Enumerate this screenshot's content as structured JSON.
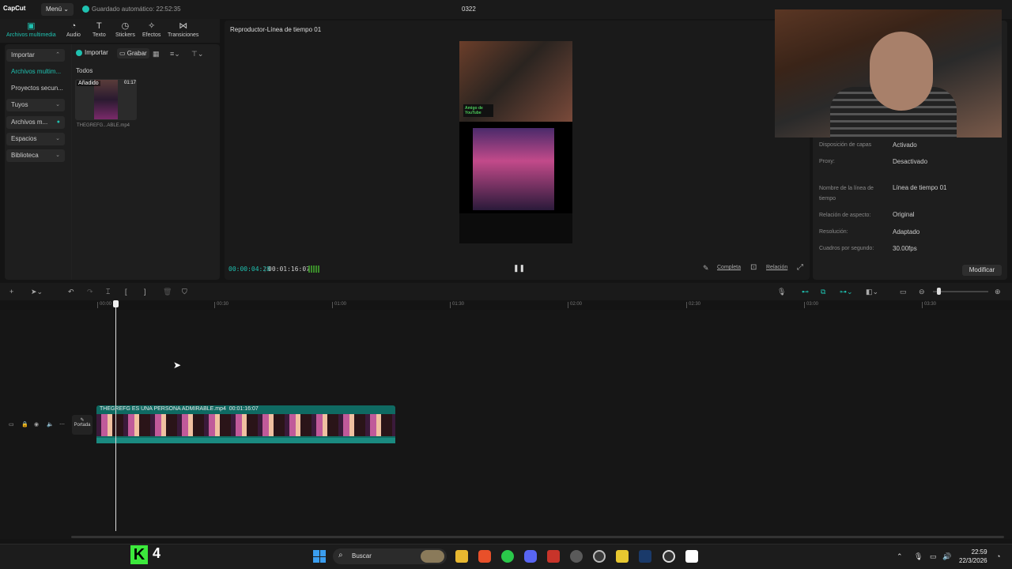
{
  "titlebar": {
    "logo": "CapCut",
    "menu_label": "Menú ⌄",
    "save_status": "Guardado automático: 22:52:35",
    "project_title": "0322"
  },
  "tool_tabs": [
    {
      "label": "Archivos multimedia",
      "icon": "media-icon",
      "active": true
    },
    {
      "label": "Audio",
      "icon": "audio-icon"
    },
    {
      "label": "Texto",
      "icon": "text-icon"
    },
    {
      "label": "Stickers",
      "icon": "sticker-icon"
    },
    {
      "label": "Efectos",
      "icon": "effects-icon"
    },
    {
      "label": "Transiciones",
      "icon": "transition-icon"
    }
  ],
  "sidebar": {
    "items": [
      {
        "label": "Importar"
      },
      {
        "label": "Archivos multim..."
      },
      {
        "label": "Proyectos secun..."
      },
      {
        "label": "Tuyos"
      },
      {
        "label": "Archivos m..."
      },
      {
        "label": "Espacios"
      },
      {
        "label": "Biblioteca"
      }
    ]
  },
  "media": {
    "import_label": "Importar",
    "record_label": "Grabar",
    "filter_label": "Todos",
    "thumb_badge": "Añadido",
    "thumb_duration": "01:17",
    "thumb_name": "THEGREFG...ABLE.mp4"
  },
  "player": {
    "title": "Reproductor-Línea de tiempo 01",
    "time_current": "00:00:04:28",
    "time_total": "00:01:16:07",
    "complete_label": "Completa",
    "ratio_label": "Relación",
    "overlay_k": "Amigo de YouTube"
  },
  "properties": [
    {
      "label": "Disposición de capas",
      "value": "Activado"
    },
    {
      "label": "Proxy:",
      "value": "Desactivado"
    },
    {
      "label": "Nombre de la línea de tiempo",
      "value": "Línea de tiempo 01"
    },
    {
      "label": "Relación de aspecto:",
      "value": "Original"
    },
    {
      "label": "Resolución:",
      "value": "Adaptado"
    },
    {
      "label": "Cuadros por segundo:",
      "value": "30.00fps"
    }
  ],
  "modify_label": "Modificar",
  "ruler": [
    "00:00",
    "00:30",
    "01:00",
    "01:30",
    "02:00",
    "02:30",
    "03:00",
    "03:30"
  ],
  "track": {
    "cover_label": "Portada",
    "clip_label": "THEGREFG ES UNA PERSONA ADMIRABLE.mp4",
    "clip_duration": "00:01:16:07"
  },
  "taskbar": {
    "overlay_number": "4",
    "search_label": "Buscar",
    "time": "22:59",
    "date": "22/3/2026"
  },
  "colors": {
    "accent": "#1fc1b0",
    "clip": "#0f6a62"
  }
}
